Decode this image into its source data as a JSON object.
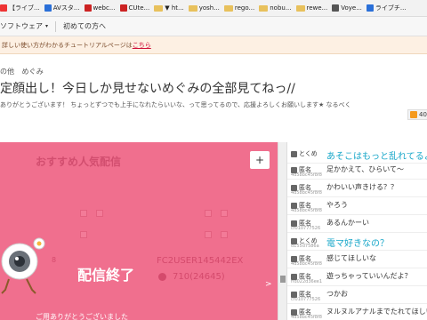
{
  "bookmarks": [
    {
      "label": "【ライブ...",
      "icon": "red"
    },
    {
      "label": "AVスタ...",
      "icon": "blue"
    },
    {
      "label": "webc...",
      "icon": "red"
    },
    {
      "label": "CUte...",
      "icon": "red"
    },
    {
      "label": "▼ ht...",
      "icon": "folder"
    },
    {
      "label": "yosh...",
      "icon": "folder"
    },
    {
      "label": "rego...",
      "icon": "folder"
    },
    {
      "label": "nobu...",
      "icon": "folder"
    },
    {
      "label": "rewe...",
      "icon": "folder"
    },
    {
      "label": "Voye...",
      "icon": "gray"
    },
    {
      "label": "ライブチ...",
      "icon": "blue"
    }
  ],
  "sitenav": {
    "item1": "ソフトウェア",
    "item1_caret": "▾",
    "item2": "初めての方へ"
  },
  "notice": {
    "text": "詳しい使い方がわかるチュートリアルページは",
    "link": "こちら"
  },
  "header": {
    "category": "の他",
    "performer": "めぐみ",
    "title": "定顔出し！今日しか見せないめぐみの全部見てねっ//",
    "description": "ありがとうございます！ ちょっとずつでも上手になれたらいいな、って思ってるので、応援よろしくお願いします★ なるべく",
    "rss_count": "40"
  },
  "panel": {
    "title": "おすすめ人気配信",
    "plus": "+",
    "user_name": "FC2USER145442EX",
    "user_id": "710(24645)",
    "left_number": "8",
    "ended_label": "配信終了",
    "arrow": ">",
    "note": "ご用ありがとうございました"
  },
  "chat": {
    "rows": [
      {
        "id": "",
        "name": "とくめ",
        "msg": "あそこはもっと乱れてるよ",
        "hi": true
      },
      {
        "id": "4d58bc45f8f8",
        "name": "匿名",
        "msg": "足かかえて、ひらいて～",
        "hi": false
      },
      {
        "id": "4d58bc45f8f8",
        "name": "匿名",
        "msg": "かわいい声きける？？",
        "hi": false
      },
      {
        "id": "4d58bc45f8f8",
        "name": "匿名",
        "msg": "やろう",
        "hi": false
      },
      {
        "id": "cf010777526",
        "name": "匿名",
        "msg": "あるんかーい",
        "hi": false
      },
      {
        "id": "d155d7586a",
        "name": "とくめ",
        "msg": "電マ好きなの？",
        "hi": true
      },
      {
        "id": "4d58bc45f8f8",
        "name": "匿名",
        "msg": "感じてほしいな",
        "hi": false
      },
      {
        "id": "ffd022d36ee1",
        "name": "匿名",
        "msg": "遊っちゃっていいんだよ？",
        "hi": false
      },
      {
        "id": "cf010777526",
        "name": "匿名",
        "msg": "つかお",
        "hi": false
      },
      {
        "id": "4d58bc45f8f8",
        "name": "匿名",
        "msg": "ヌルヌルアナルまでたれてほしい",
        "hi": false
      }
    ]
  }
}
